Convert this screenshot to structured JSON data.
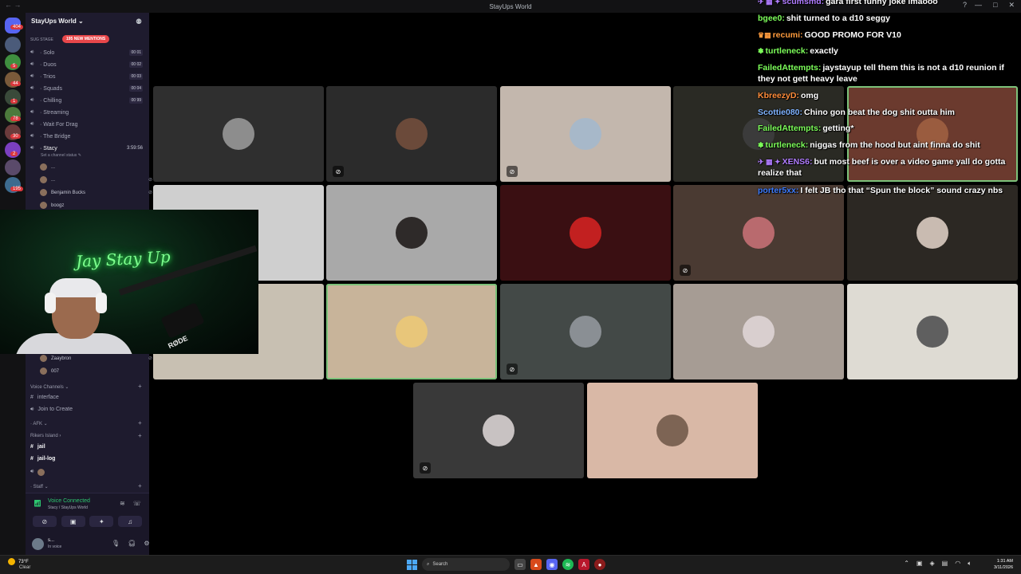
{
  "window": {
    "title": "StayUps World",
    "nav": "← →",
    "help": "?"
  },
  "rail": {
    "top_badge": "404",
    "badges": [
      {
        "text": "5"
      },
      {
        "text": "44"
      },
      {
        "text": "1"
      },
      {
        "text": "78"
      },
      {
        "text": "30"
      },
      {
        "text": "2"
      },
      {
        "text": "195"
      }
    ]
  },
  "sidebar": {
    "server_name": "StayUps World ⌄",
    "stage_label": "SUG STAGE",
    "mentions": "195 NEW MENTIONS",
    "channels": [
      {
        "name": "· Solo",
        "limit_a": "00",
        "limit_b": "01"
      },
      {
        "name": "· Duos",
        "limit_a": "00",
        "limit_b": "02"
      },
      {
        "name": "· Trios",
        "limit_a": "00",
        "limit_b": "03"
      },
      {
        "name": "· Squads",
        "limit_a": "00",
        "limit_b": "04"
      },
      {
        "name": "· Chilling",
        "limit_a": "00",
        "limit_b": "99"
      },
      {
        "name": "· Streaming"
      },
      {
        "name": "· Wait For Drag"
      },
      {
        "name": "· The Bridge"
      }
    ],
    "active_channel": {
      "name": "· Stacy",
      "timer": "3:59:56",
      "status": "Set a channel status ✎"
    },
    "members": [
      {
        "name": "..."
      },
      {
        "name": "..."
      },
      {
        "name": "Benjamin Bucks"
      },
      {
        "name": "boogz"
      }
    ],
    "lower_members": [
      {
        "name": "Zaaybron"
      },
      {
        "name": "007"
      }
    ],
    "sections": {
      "voice_channels": "Voice Channels ⌄",
      "interface": "interface",
      "join_to_create": "Join to Create",
      "afk": "· AFK ⌄",
      "rikers": "Rikers Island ›",
      "jail": "jail",
      "jail_log": "jail-log",
      "staff": "· Staff ⌄"
    },
    "voice": {
      "connected": "Voice Connected",
      "location": "Stacy / StayUps World"
    },
    "user": {
      "name": "s...",
      "status": "In voice"
    }
  },
  "webcam": {
    "neon_text": "Jay Stay Up",
    "mic_brand": "RØDE"
  },
  "grid": {
    "tiles": [
      {
        "bg": "#2f2f2f",
        "avatar": "#8d8d8d",
        "muted": false
      },
      {
        "bg": "#2b2b2b",
        "avatar": "#6b4a3a",
        "muted": true
      },
      {
        "bg": "#c3b7ad",
        "avatar": "#a7b8c9",
        "muted": true
      },
      {
        "bg": "#2a2a24",
        "avatar": "#3b3b3b",
        "muted": false
      },
      {
        "bg": "#6b3a2e",
        "avatar": "#9a5c3f",
        "muted": false,
        "speaking": true
      },
      {
        "bg": "#cfcfcf",
        "avatar": "#b9b9b9",
        "muted": false
      },
      {
        "bg": "#a9a9a9",
        "avatar": "#2e2a29",
        "muted": false
      },
      {
        "bg": "#3a0f12",
        "avatar": "#c22020",
        "muted": false
      },
      {
        "bg": "#4a3a32",
        "avatar": "#b96a6e",
        "muted": true
      },
      {
        "bg": "#2c2823",
        "avatar": "#c9bbb1",
        "muted": false
      },
      {
        "bg": "#c8c0b2",
        "avatar": "#c9c0b6",
        "muted": false
      },
      {
        "bg": "#c8b49a",
        "avatar": "#e8c67a",
        "muted": false,
        "speaking": true
      },
      {
        "bg": "#434947",
        "avatar": "#8a8f94",
        "muted": true
      },
      {
        "bg": "#a69c94",
        "avatar": "#d9cfcf",
        "muted": false
      },
      {
        "bg": "#dedbd3",
        "avatar": "#5f5f5f",
        "muted": false
      },
      {
        "bg": "#393939",
        "avatar": "#c8c2c2",
        "muted": true
      },
      {
        "bg": "#d9b8a6",
        "avatar": "#7d6454",
        "muted": false
      }
    ]
  },
  "chat": [
    {
      "badge": "✈ ▦ ✦",
      "name": "scumsmd:",
      "color": "#b07cff",
      "text": "gara first funny joke lmaooo"
    },
    {
      "badge": "",
      "name": "bgee0:",
      "color": "#7dff5a",
      "text": "shit turned to a d10 seggy"
    },
    {
      "badge": "♛▦",
      "name": "recumi:",
      "color": "#ff9b3d",
      "text": "GOOD PROMO FOR V10"
    },
    {
      "badge": "✽",
      "name": "turtleneck:",
      "color": "#7dff5a",
      "text": "exactly"
    },
    {
      "badge": "",
      "name": "FailedAttempts:",
      "color": "#7dff5a",
      "text": "jaystayup tell them this is not a d10 reunion if they not gett heavy leave"
    },
    {
      "badge": "",
      "name": "KbreezyD:",
      "color": "#ff8c3a",
      "text": "omg"
    },
    {
      "badge": "",
      "name": "Scottie080:",
      "color": "#7fb3ff",
      "text": "Chino gon beat the dog shit outta him"
    },
    {
      "badge": "",
      "name": "FailedAttempts:",
      "color": "#7dff5a",
      "text": "getting*"
    },
    {
      "badge": "✽",
      "name": "turtleneck:",
      "color": "#7dff5a",
      "text": "niggas from the hood but aint finna do shit"
    },
    {
      "badge": "✈ ▦ ✦",
      "name": "XENS6:",
      "color": "#b07cff",
      "text": "but most beef is over a video game yall do gotta realize that"
    },
    {
      "badge": "",
      "name": "porter5xx:",
      "color": "#3c7bff",
      "text": "I felt JB tho that “Spun the block” sound crazy nbs"
    }
  ],
  "taskbar": {
    "temp": "73°F",
    "weather": "Clear",
    "search": "Search",
    "time": "1:31 AM",
    "date": "3/11/2026"
  }
}
